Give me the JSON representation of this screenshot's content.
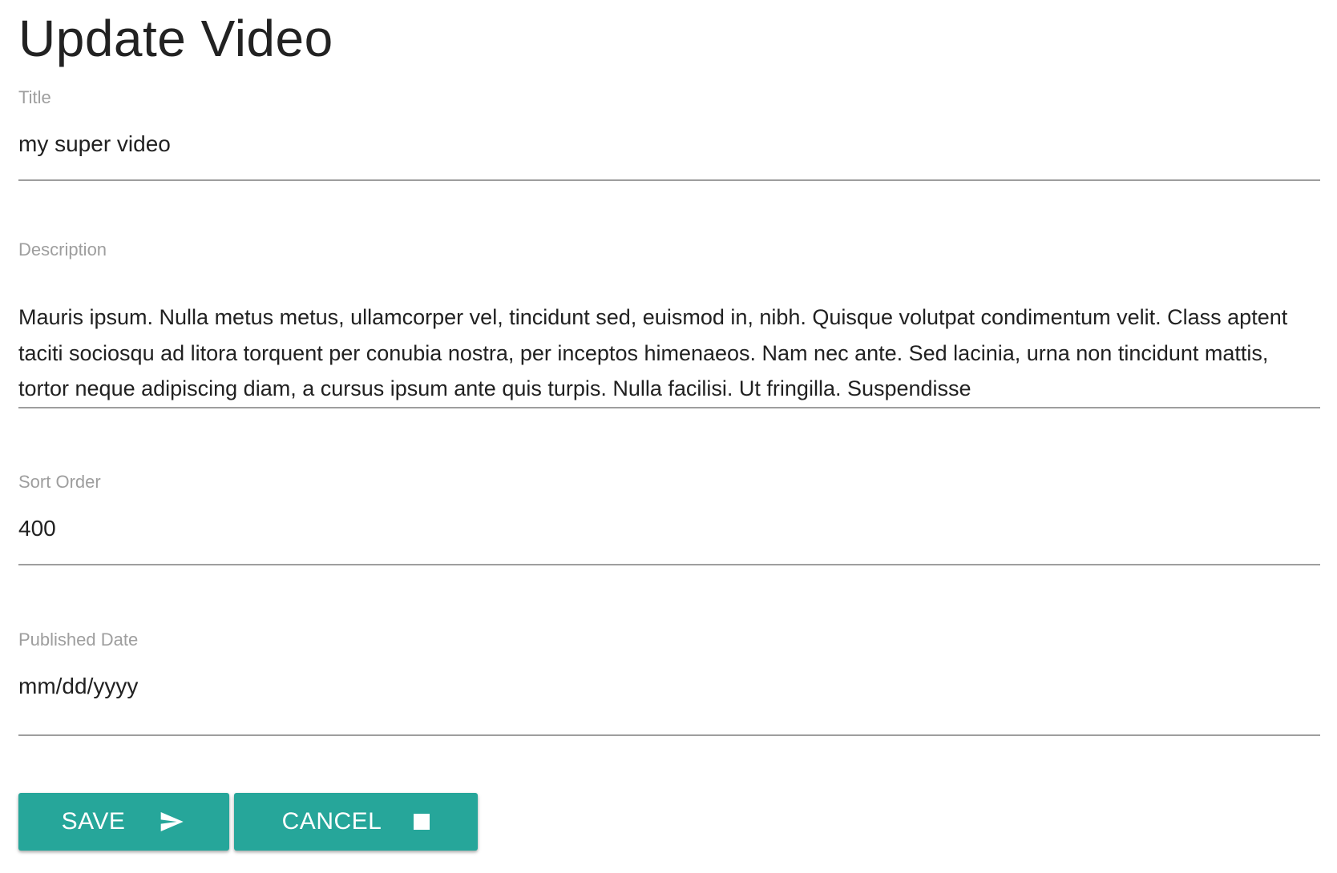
{
  "page": {
    "title": "Update Video"
  },
  "form": {
    "title": {
      "label": "Title",
      "value": "my super video"
    },
    "description": {
      "label": "Description",
      "value": "Mauris ipsum. Nulla metus metus, ullamcorper vel, tincidunt sed, euismod in, nibh. Quisque volutpat condimentum velit. Class aptent taciti sociosqu ad litora torquent per conubia nostra, per inceptos himenaeos. Nam nec ante. Sed lacinia, urna non tincidunt mattis, tortor neque adipiscing diam, a cursus ipsum ante quis turpis. Nulla facilisi. Ut fringilla. Suspendisse"
    },
    "sort_order": {
      "label": "Sort Order",
      "value": "400"
    },
    "published_date": {
      "label": "Published Date",
      "value": "mm/dd/yyyy"
    }
  },
  "buttons": {
    "save": {
      "label": "SAVE",
      "icon": "send-icon"
    },
    "cancel": {
      "label": "CANCEL",
      "icon": "stop-icon"
    }
  },
  "colors": {
    "accent": "#26a69a",
    "label": "#9e9e9e",
    "text": "#212121",
    "underline": "#9e9e9e"
  }
}
